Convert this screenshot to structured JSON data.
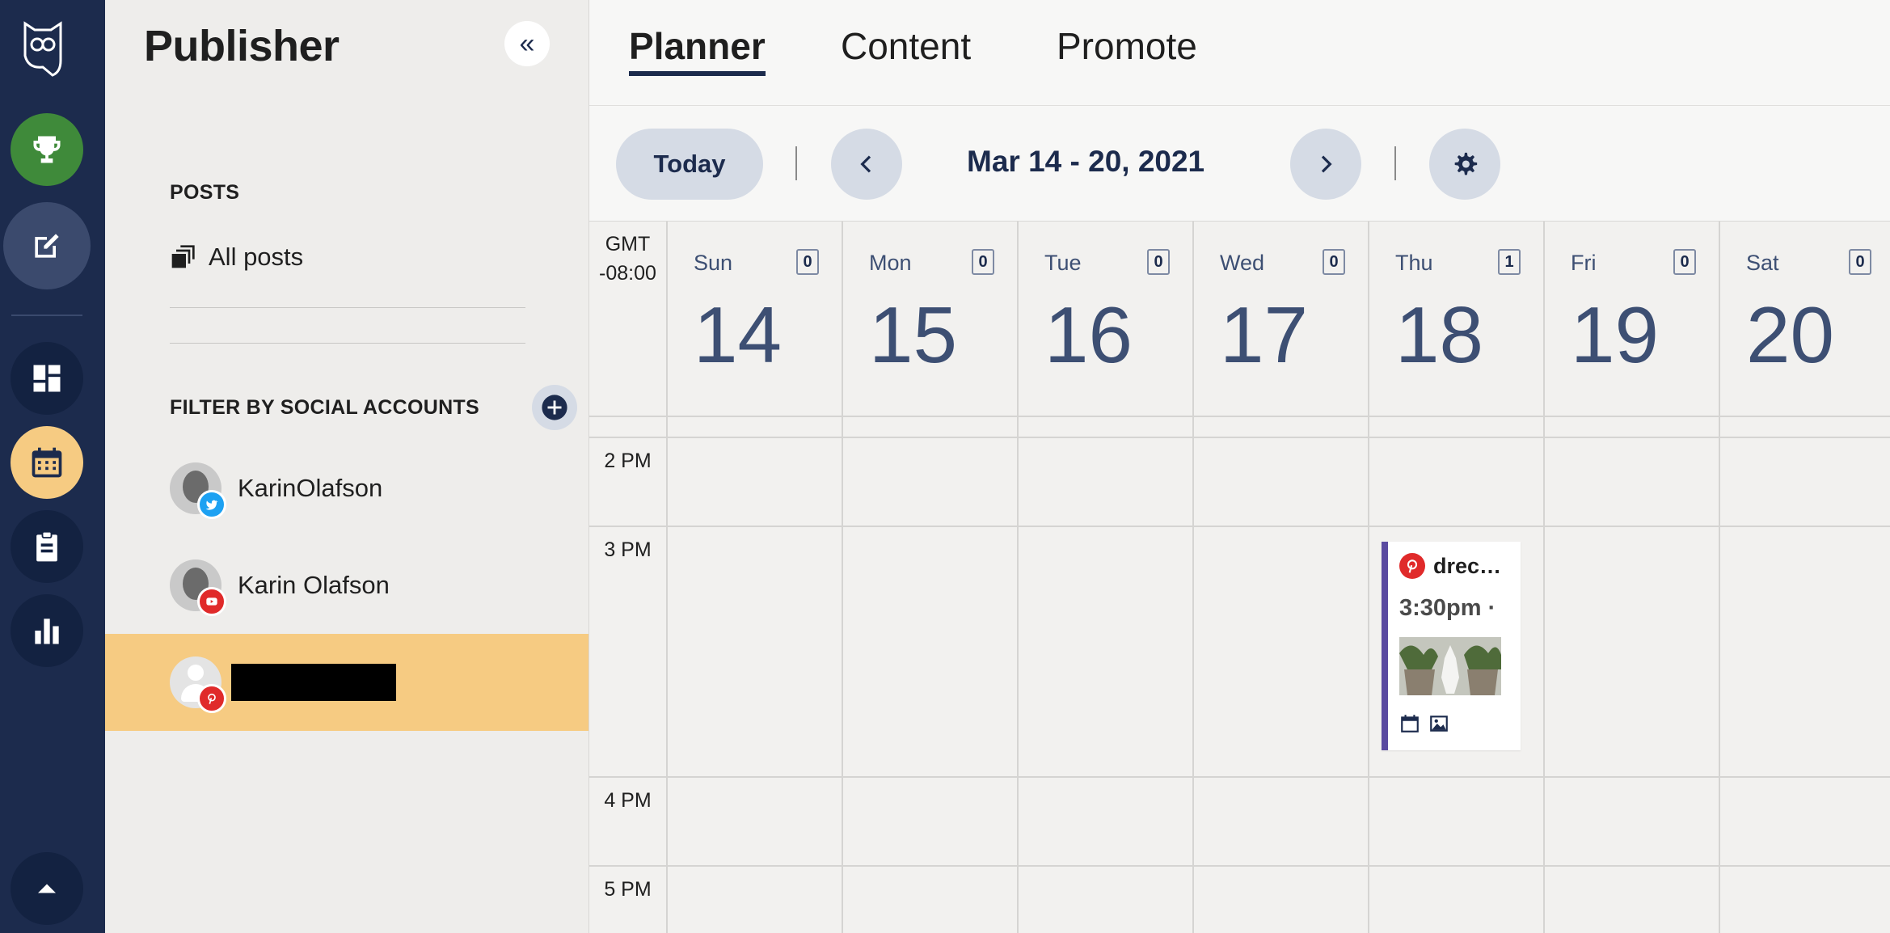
{
  "sidebar": {
    "title": "Publisher",
    "posts_label": "POSTS",
    "all_posts": "All posts",
    "filter_label": "FILTER BY SOCIAL ACCOUNTS",
    "accounts": [
      {
        "name": "KarinOlafson",
        "network": "twitter"
      },
      {
        "name": "Karin Olafson",
        "network": "youtube"
      },
      {
        "name": "",
        "network": "pinterest",
        "redacted": true
      }
    ]
  },
  "tabs": [
    "Planner",
    "Content",
    "Promote"
  ],
  "toolbar": {
    "today": "Today",
    "range": "Mar 14 - 20, 2021"
  },
  "calendar": {
    "timezone_line1": "GMT",
    "timezone_line2": "-08:00",
    "days": [
      {
        "name": "Sun",
        "num": "14",
        "count": "0"
      },
      {
        "name": "Mon",
        "num": "15",
        "count": "0"
      },
      {
        "name": "Tue",
        "num": "16",
        "count": "0"
      },
      {
        "name": "Wed",
        "num": "17",
        "count": "0"
      },
      {
        "name": "Thu",
        "num": "18",
        "count": "1"
      },
      {
        "name": "Fri",
        "num": "19",
        "count": "0"
      },
      {
        "name": "Sat",
        "num": "20",
        "count": "0"
      }
    ],
    "hours": [
      "2 PM",
      "3 PM",
      "4 PM",
      "5 PM"
    ],
    "event": {
      "title": "drec…",
      "time": "3:30pm ·",
      "network": "pinterest"
    }
  },
  "colors": {
    "rail": "#1c2b4d",
    "selected_account": "#f6cb82",
    "accent_green": "#3f8a3a",
    "accent_yellow": "#f6cb82"
  }
}
